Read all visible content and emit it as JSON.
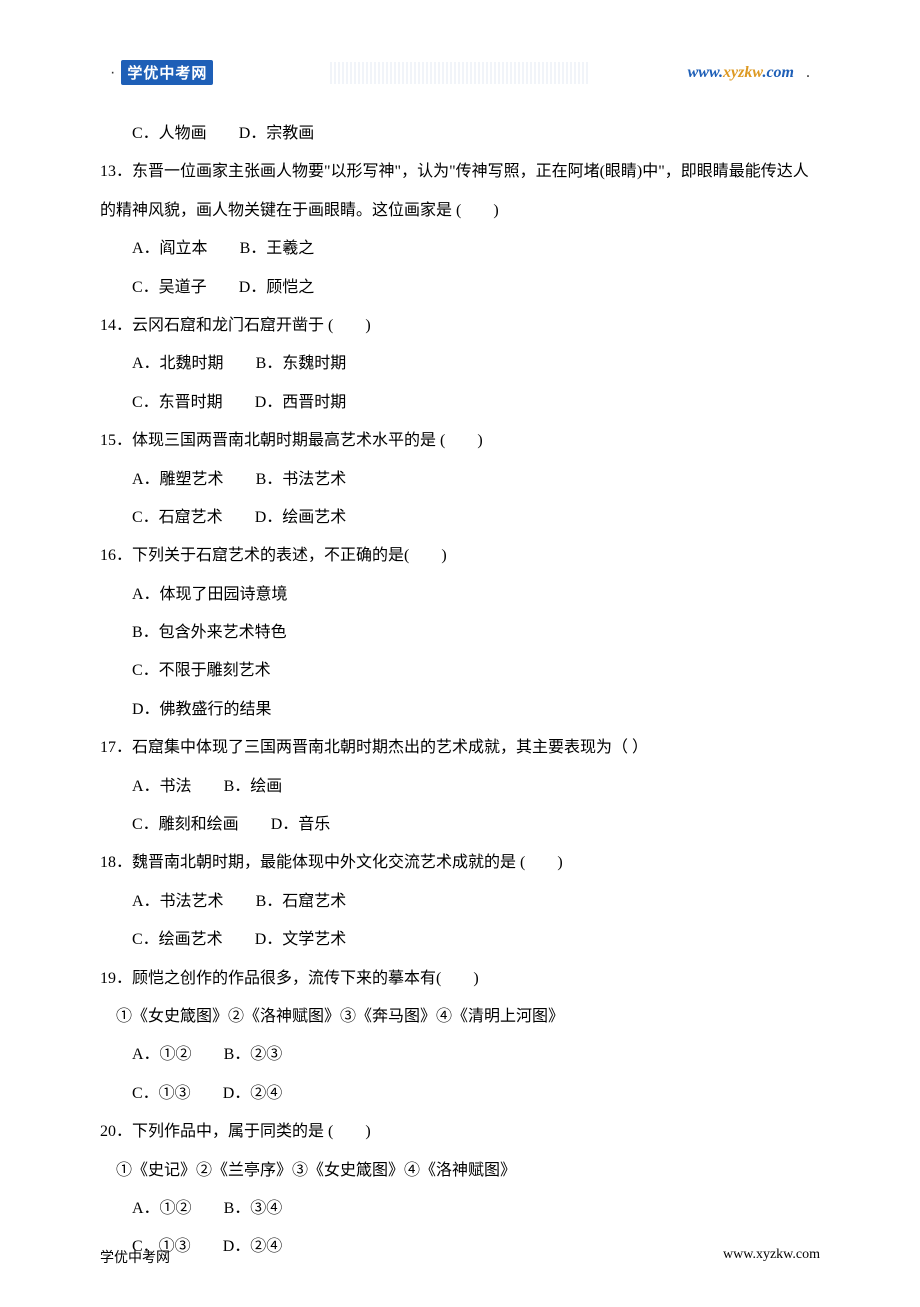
{
  "header": {
    "logo_text": "学优中考网",
    "url_part1": "www.",
    "url_part2": "xyzkw",
    "url_part3": ".com",
    "trail": "."
  },
  "orphan_options": {
    "c": "C．人物画",
    "d": "D．宗教画"
  },
  "questions": [
    {
      "num": "13",
      "text": "．东晋一位画家主张画人物要\"以形写神\"，认为\"传神写照，正在阿堵(眼睛)中\"，即眼睛最能传达人的精神风貌，画人物关键在于画眼睛。这位画家是 (　　)",
      "options_rows": [
        [
          "A．阎立本",
          "B．王羲之"
        ],
        [
          "C．吴道子",
          "D．顾恺之"
        ]
      ]
    },
    {
      "num": "14",
      "text": "．云冈石窟和龙门石窟开凿于 (　　)",
      "options_rows": [
        [
          "A．北魏时期",
          "B．东魏时期"
        ],
        [
          "C．东晋时期",
          "D．西晋时期"
        ]
      ]
    },
    {
      "num": "15",
      "text": "．体现三国两晋南北朝时期最高艺术水平的是 (　　)",
      "options_rows": [
        [
          "A．雕塑艺术",
          "B．书法艺术"
        ],
        [
          "C．石窟艺术",
          "D．绘画艺术"
        ]
      ]
    },
    {
      "num": "16",
      "text": "．下列关于石窟艺术的表述，不正确的是(　　)",
      "options_rows": [
        [
          "A．体现了田园诗意境"
        ],
        [
          "B．包含外来艺术特色"
        ],
        [
          "C．不限于雕刻艺术"
        ],
        [
          "D．佛教盛行的结果"
        ]
      ]
    },
    {
      "num": "17",
      "text": "．石窟集中体现了三国两晋南北朝时期杰出的艺术成就，其主要表现为（  ）",
      "options_rows": [
        [
          "A．书法",
          "B．绘画"
        ],
        [
          "C．雕刻和绘画",
          "D．音乐"
        ]
      ]
    },
    {
      "num": "18",
      "text": "．魏晋南北朝时期，最能体现中外文化交流艺术成就的是 (　　)",
      "options_rows": [
        [
          "A．书法艺术",
          "B．石窟艺术"
        ],
        [
          "C．绘画艺术",
          "D．文学艺术"
        ]
      ]
    },
    {
      "num": "19",
      "text": "．顾恺之创作的作品很多，流传下来的摹本有(　　)",
      "sub": "①《女史箴图》②《洛神赋图》③《奔马图》④《清明上河图》",
      "options_rows": [
        [
          "A．①②",
          "B．②③"
        ],
        [
          "C．①③",
          "D．②④"
        ]
      ]
    },
    {
      "num": "20",
      "text": "．下列作品中，属于同类的是 (　　)",
      "sub": "①《史记》②《兰亭序》③《女史箴图》④《洛神赋图》",
      "options_rows": [
        [
          "A．①②",
          "B．③④"
        ],
        [
          "C．①③",
          "D．②④"
        ]
      ]
    }
  ],
  "footer": {
    "left": "学优中考网",
    "right": "www.xyzkw.com"
  }
}
